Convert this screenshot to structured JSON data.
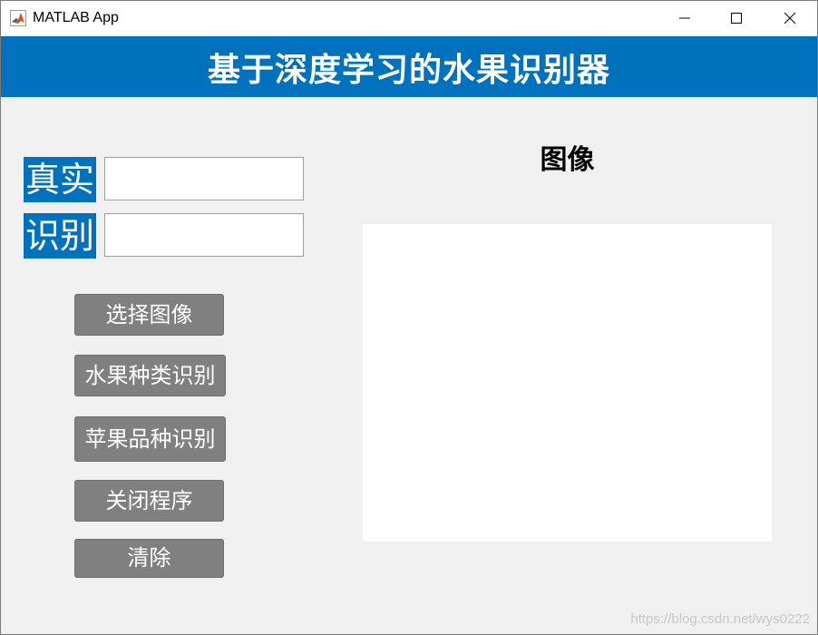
{
  "window": {
    "title": "MATLAB App",
    "app_icon": "matlab-icon",
    "controls": [
      "minimize-icon",
      "maximize-icon",
      "close-icon"
    ]
  },
  "banner": {
    "title": "基于深度学习的水果识别器",
    "background": "#0072bd"
  },
  "fields": {
    "true_label": "真实",
    "true_value": "",
    "recognized_label": "识别",
    "recognized_value": ""
  },
  "buttons": {
    "select_image": "选择图像",
    "fruit_type": "水果种类识别",
    "apple_variety": "苹果品种识别",
    "close_program": "关闭程序",
    "clear": "清除",
    "background": "#808080"
  },
  "image_panel": {
    "title": "图像"
  },
  "watermark": "https://blog.csdn.net/wys0222"
}
